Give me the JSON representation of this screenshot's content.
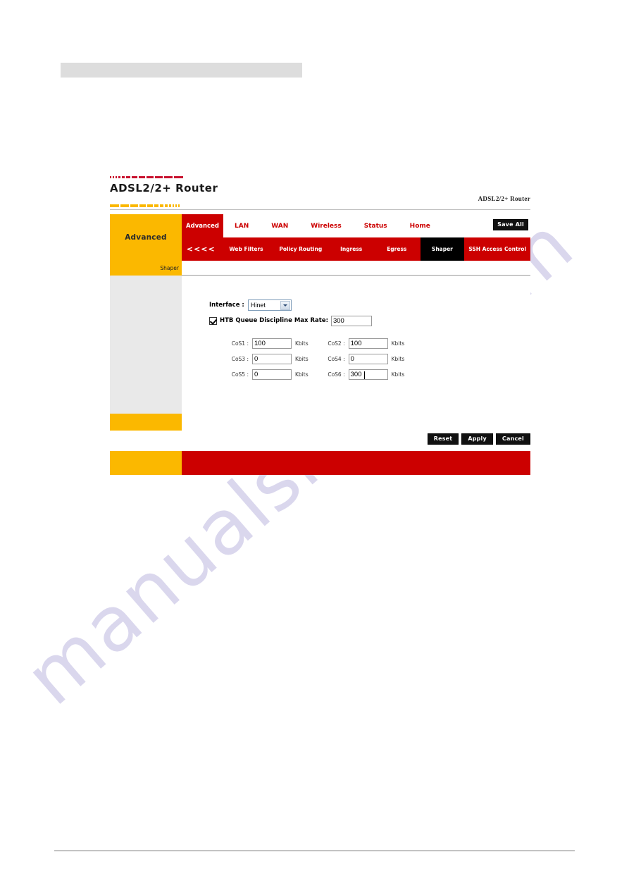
{
  "page": {
    "top_bar_label": "",
    "watermark": "manualshive.com"
  },
  "branding": {
    "logo_text": "ADSL2/2+ Router",
    "corner_text": "ADSL2/2+ Router"
  },
  "nav": {
    "section_label": "Advanced",
    "primary": [
      {
        "label": "Advanced",
        "active": true
      },
      {
        "label": "LAN",
        "active": false
      },
      {
        "label": "WAN",
        "active": false
      },
      {
        "label": "Wireless",
        "active": false
      },
      {
        "label": "Status",
        "active": false
      },
      {
        "label": "Home",
        "active": false
      }
    ],
    "save_all_label": "Save All",
    "secondary": [
      {
        "label": "<<<<",
        "active": false
      },
      {
        "label": "Web Filters",
        "active": false
      },
      {
        "label": "Policy Routing",
        "active": false
      },
      {
        "label": "Ingress",
        "active": false
      },
      {
        "label": "Egress",
        "active": false
      },
      {
        "label": "Shaper",
        "active": true
      },
      {
        "label": "SSH Access Control",
        "active": false
      }
    ]
  },
  "sidebar": {
    "header_label": "Shaper"
  },
  "form": {
    "interface_label": "Interface :",
    "interface_value": "Hinet",
    "htb_label": "HTB Queue Discipline  Max Rate:",
    "htb_checked": true,
    "max_rate_value": "300",
    "unit": "Kbits",
    "cos_fields": [
      {
        "label": "CoS1 :",
        "value": "100",
        "caret": false
      },
      {
        "label": "CoS2 :",
        "value": "100",
        "caret": false
      },
      {
        "label": "CoS3 :",
        "value": "0",
        "caret": false
      },
      {
        "label": "CoS4 :",
        "value": "0",
        "caret": false
      },
      {
        "label": "CoS5 :",
        "value": "0",
        "caret": false
      },
      {
        "label": "CoS6 :",
        "value": "300",
        "caret": true
      }
    ]
  },
  "actions": {
    "reset_label": "Reset",
    "apply_label": "Apply",
    "cancel_label": "Cancel"
  },
  "colors": {
    "red": "#CC0000",
    "gold": "#FBB800",
    "black": "#000000",
    "panel_gray": "#e9e9e9"
  }
}
